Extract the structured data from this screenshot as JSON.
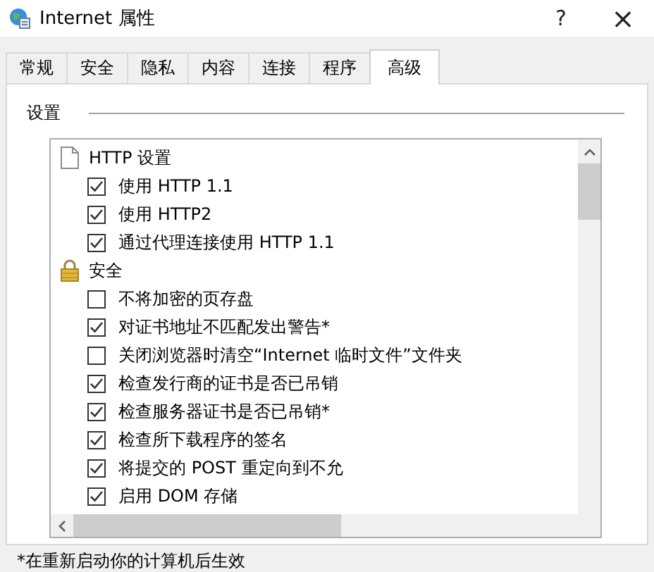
{
  "window": {
    "title": "Internet 属性",
    "help": "?",
    "close": "×"
  },
  "tabs": [
    {
      "label": "常规",
      "selected": false
    },
    {
      "label": "安全",
      "selected": false
    },
    {
      "label": "隐私",
      "selected": false
    },
    {
      "label": "内容",
      "selected": false
    },
    {
      "label": "连接",
      "selected": false
    },
    {
      "label": "程序",
      "selected": false
    },
    {
      "label": "高级",
      "selected": true
    }
  ],
  "settings": {
    "label": "设置",
    "groups": [
      {
        "kind": "page",
        "label": "HTTP 设置",
        "children": [
          {
            "label": "使用 HTTP 1.1",
            "checked": true
          },
          {
            "label": "使用 HTTP2",
            "checked": true
          },
          {
            "label": "通过代理连接使用 HTTP 1.1",
            "checked": true
          }
        ]
      },
      {
        "kind": "lock",
        "label": "安全",
        "children": [
          {
            "label": "不将加密的页存盘",
            "checked": false
          },
          {
            "label": "对证书地址不匹配发出警告*",
            "checked": true
          },
          {
            "label": "关闭浏览器时清空“Internet 临时文件”文件夹",
            "checked": false
          },
          {
            "label": "检查发行商的证书是否已吊销",
            "checked": true
          },
          {
            "label": "检查服务器证书是否已吊销*",
            "checked": true
          },
          {
            "label": "检查所下载程序的签名",
            "checked": true
          },
          {
            "label": "将提交的 POST 重定向到不允",
            "checked": true
          },
          {
            "label": "启用 DOM 存储",
            "checked": true
          }
        ]
      }
    ]
  },
  "footnote": "*在重新启动你的计算机后生效"
}
